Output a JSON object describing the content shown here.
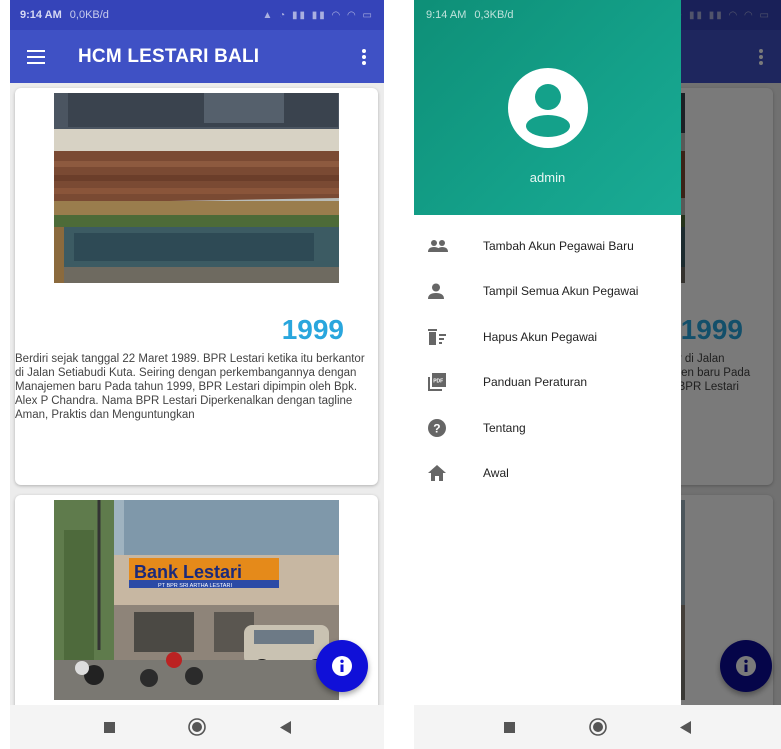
{
  "status_bar": {
    "left_time": "9:14 AM",
    "left_speed": "0,0KB/d",
    "right_time": "9:14 AM",
    "right_speed": "0,3KB/d"
  },
  "app_bar": {
    "title": "HCM LESTARI BALI",
    "menu_icon": "hamburger-menu-icon",
    "overflow_icon": "more-vert-icon"
  },
  "card1": {
    "year": "1999",
    "description": "Berdiri sejak tanggal 22 Maret 1989. BPR Lestari ketika itu berkantor di Jalan Setiabudi Kuta. Seiring dengan perkembangannya dengan Manajemen baru Pada tahun 1999, BPR Lestari dipimpin oleh Bpk. Alex P Chandra. Nama BPR Lestari Diperkenalkan dengan tagline Aman, Praktis dan Menguntungkan"
  },
  "card2": {
    "sign_text": "Bank Lestari",
    "sign_subtext": "PT BPR SRI ARTHA LESTARI"
  },
  "drawer": {
    "user_name": "admin",
    "items": [
      {
        "label": "Tambah Akun Pegawai Baru",
        "icon": "people-icon"
      },
      {
        "label": "Tampil Semua Akun Pegawai",
        "icon": "person-icon"
      },
      {
        "label": "Hapus Akun Pegawai",
        "icon": "delete-sweep-icon"
      },
      {
        "label": "Panduan Peraturan",
        "icon": "picture-as-pdf-icon"
      },
      {
        "label": "Tentang",
        "icon": "help-icon"
      },
      {
        "label": "Awal",
        "icon": "home-icon"
      }
    ]
  },
  "nav_bar": {
    "recents_icon": "square-recents-icon",
    "home_icon": "circle-home-icon",
    "back_icon": "triangle-back-icon"
  },
  "colors": {
    "app_bar": "#3f51c5",
    "status_bar": "#3544b9",
    "drawer_header": "#14a18a",
    "year": "#29a6dd",
    "fab": "#1010d8"
  },
  "fab_icon": "info-icon"
}
